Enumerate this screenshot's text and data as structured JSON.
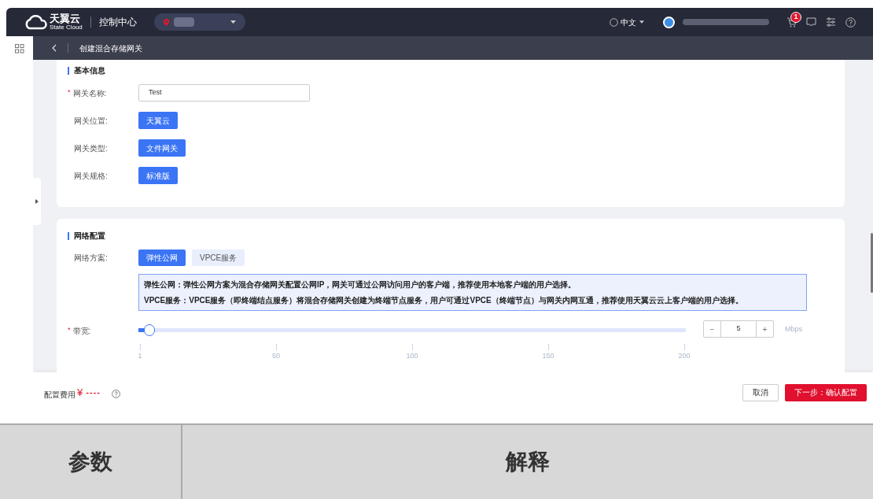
{
  "header": {
    "logo_name": "天翼云",
    "logo_sub": "State Cloud",
    "console": "控制中心",
    "language": "中文",
    "cart_badge": "1"
  },
  "subbar": {
    "title": "创建混合存储网关"
  },
  "basic": {
    "title": "基本信息",
    "name_field": {
      "label": "网关名称:",
      "required_mark": "*",
      "value": "Test"
    },
    "rows": [
      {
        "label": "网关位置:",
        "option": "天翼云",
        "selected": true
      },
      {
        "label": "网关类型:",
        "option": "文件网关",
        "selected": true
      },
      {
        "label": "网关规格:",
        "option": "标准版",
        "selected": true
      }
    ]
  },
  "network": {
    "title": "网络配置",
    "scheme_label": "网络方案:",
    "options": [
      {
        "label": "弹性公网",
        "selected": true
      },
      {
        "label": "VPCE服务",
        "selected": false
      }
    ],
    "notes": [
      "弹性公网：弹性公网方案为混合存储网关配置公网IP，网关可通过公网访问用户的客户端，推荐使用本地客户端的用户选择。",
      "VPCE服务：VPCE服务（即终端结点服务）将混合存储网关创建为终端节点服务，用户可通过VPCE（终端节点）与网关内网互通，推荐使用天翼云云上客户端的用户选择。"
    ],
    "bandwidth": {
      "label": "带宽:",
      "required_mark": "*",
      "level": 0.02,
      "ticks": [
        "1",
        "50",
        "100",
        "150",
        "200"
      ],
      "minus": "−",
      "value": "5",
      "plus": "+",
      "unit": "Mbps"
    }
  },
  "footer": {
    "cost_label": "配置费用",
    "currency": "¥",
    "cost": "----",
    "cancel": "取消",
    "next": "下一步：确认配置"
  },
  "table": {
    "columns": [
      "参数",
      "解释"
    ]
  }
}
